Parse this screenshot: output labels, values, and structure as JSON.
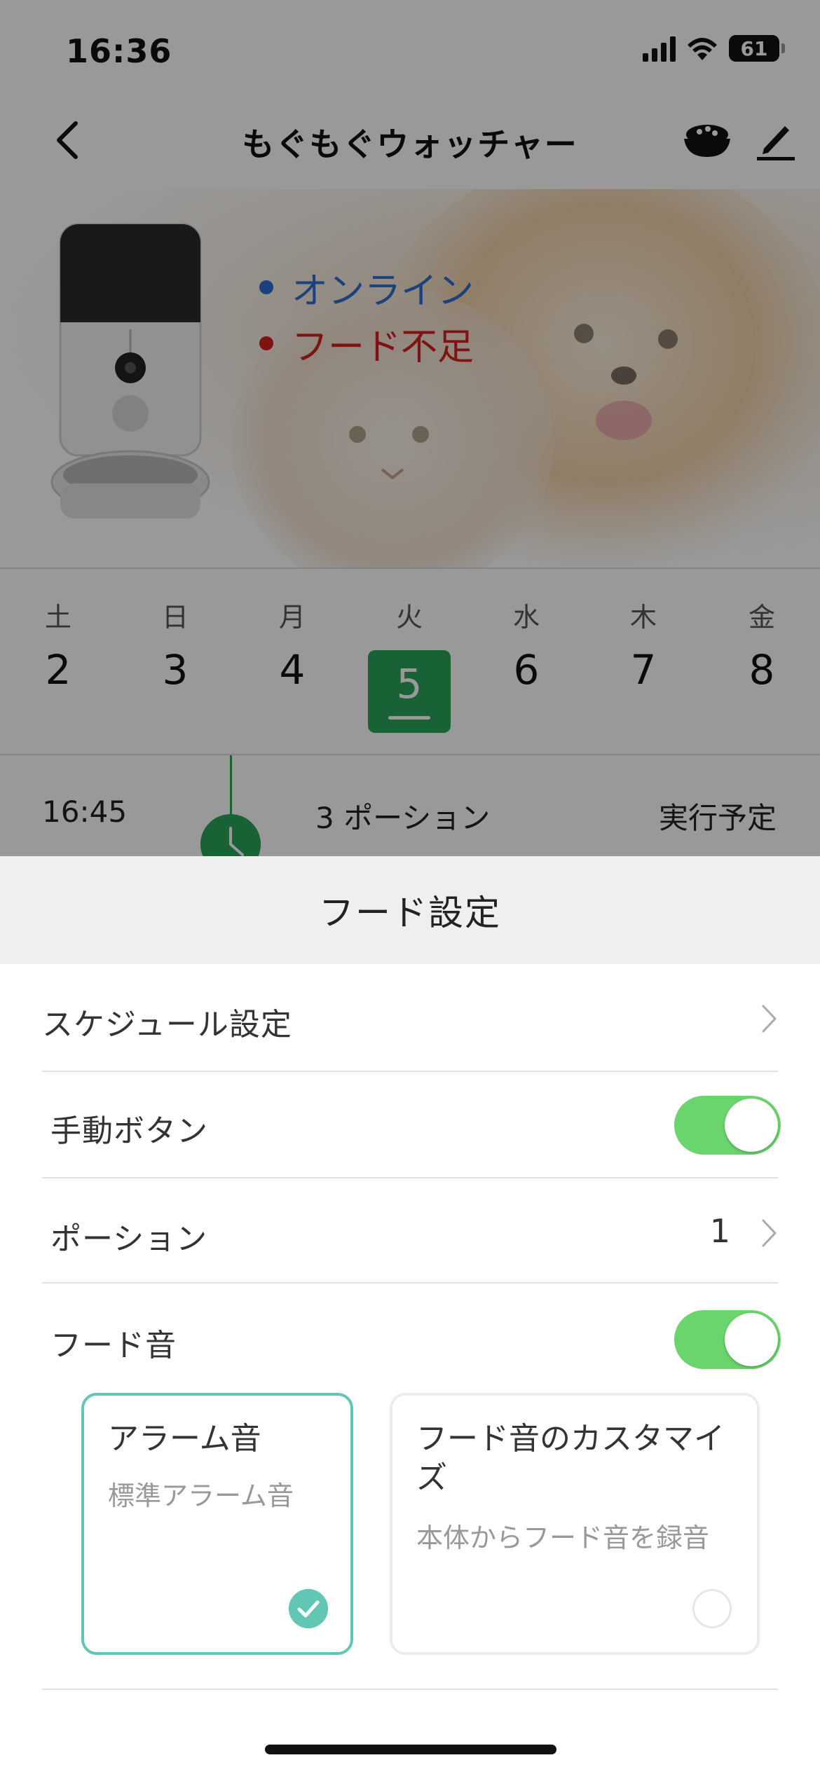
{
  "status_bar": {
    "time": "16:36",
    "battery": "61"
  },
  "nav": {
    "title": "もぐもぐウォッチャー",
    "back_icon": "chevron-left-icon",
    "bowl_icon": "pet-bowl-icon",
    "edit_icon": "pencil-icon"
  },
  "device": {
    "online_label": "オンライン",
    "food_status_label": "フード不足",
    "online_color": "#2f6fd1",
    "warning_color": "#d41e1e"
  },
  "week": {
    "days": [
      {
        "weekday": "土",
        "date": "2"
      },
      {
        "weekday": "日",
        "date": "3"
      },
      {
        "weekday": "月",
        "date": "4"
      },
      {
        "weekday": "火",
        "date": "5"
      },
      {
        "weekday": "水",
        "date": "6"
      },
      {
        "weekday": "木",
        "date": "7"
      },
      {
        "weekday": "金",
        "date": "8"
      }
    ],
    "selected_date": "5",
    "accent_color": "#2aa35a"
  },
  "feed_item": {
    "time": "16:45",
    "portion": "3 ポーション",
    "state": "実行予定"
  },
  "sheet": {
    "title": "フード設定",
    "schedule_label": "スケジュール設定",
    "manual_button_label": "手動ボタン",
    "manual_button_on": true,
    "portion_label": "ポーション",
    "portion_value": "1",
    "food_sound_label": "フード音",
    "food_sound_on": true,
    "options": [
      {
        "title": "アラーム音",
        "subtitle": "標準アラーム音",
        "selected": true
      },
      {
        "title": "フード音のカスタマイズ",
        "subtitle": "本体からフード音を録音",
        "selected": false
      }
    ],
    "toggle_color": "#6bd56d",
    "selection_color": "#62c6b4"
  }
}
